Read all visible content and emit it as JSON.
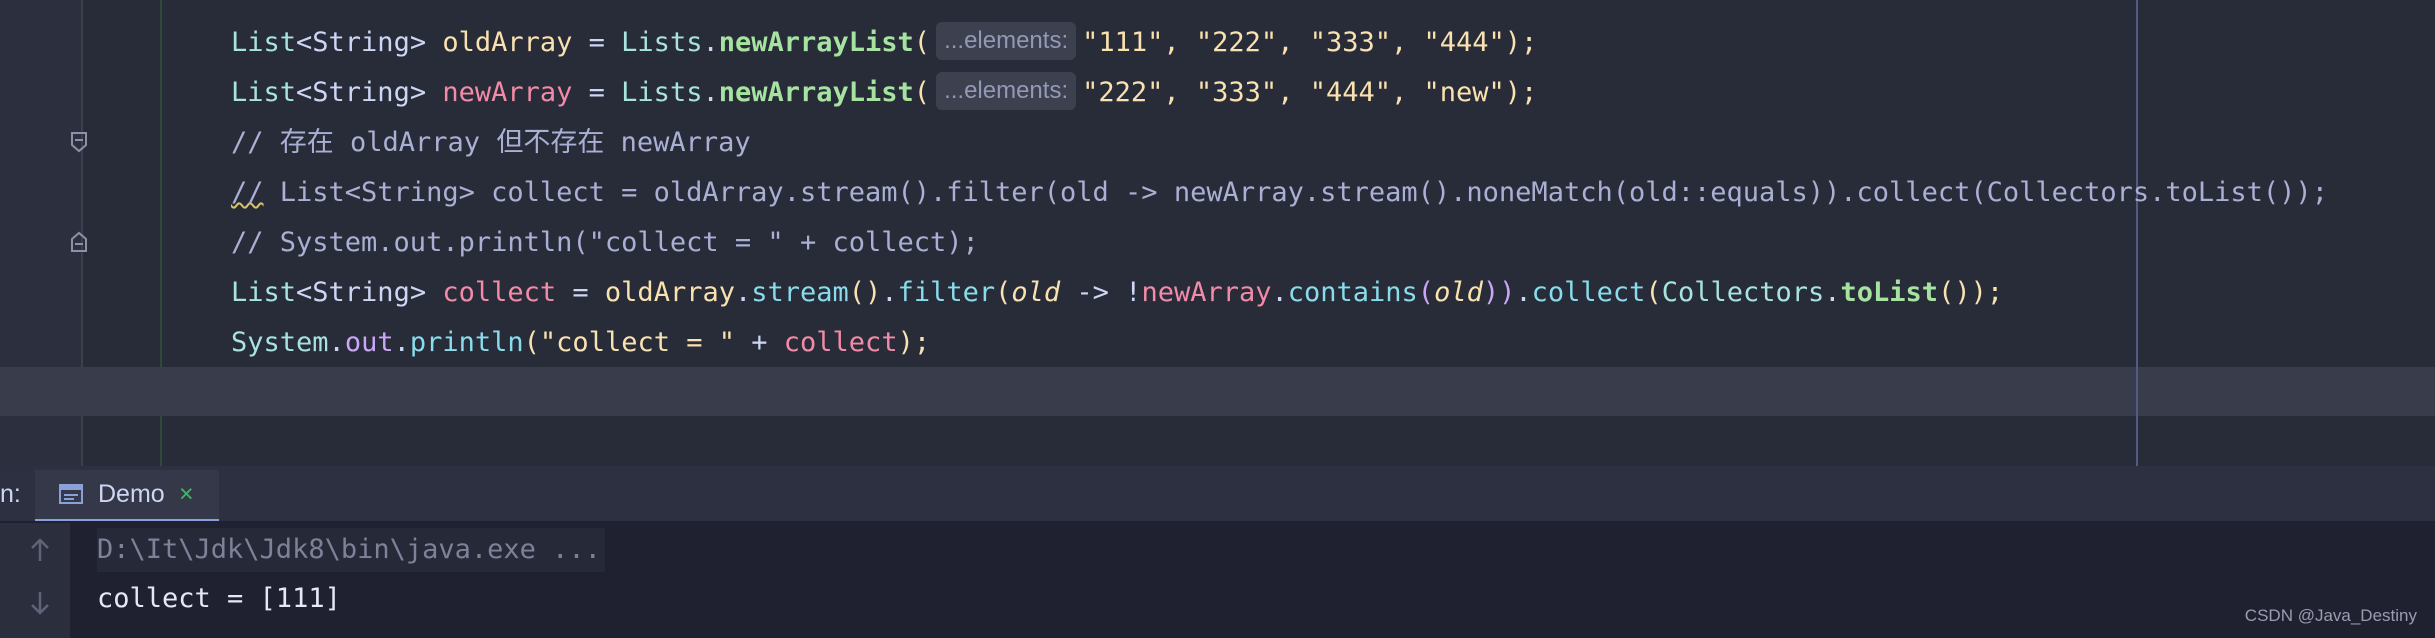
{
  "editor": {
    "line1": {
      "type_name": "List",
      "generic": "<String>",
      "var_name": "oldArray",
      "assign": " = ",
      "class_name": "Lists",
      "dot": ".",
      "method": "newArrayList",
      "open_paren": "(",
      "hint": "...elements:",
      "args": "\"111\", \"222\", \"333\", \"444\"",
      "close": ");"
    },
    "line2": {
      "type_name": "List",
      "generic": "<String>",
      "var_name": "newArray",
      "assign": " = ",
      "class_name": "Lists",
      "dot": ".",
      "method": "newArrayList",
      "open_paren": "(",
      "hint": "...elements:",
      "args": "\"222\", \"333\", \"444\", \"new\"",
      "close": ");"
    },
    "comment1": "// 存在 oldArray 但不存在 newArray",
    "comment2_prefix": "//",
    "comment2_rest": " List<String> collect = oldArray.stream().filter(old -> newArray.stream().noneMatch(old::equals)).collect(Collectors.toList());",
    "comment3": "// System.out.println(\"collect = \" + collect);",
    "line6": {
      "type_name": "List",
      "generic": "<String>",
      "var_name": "collect",
      "assign": " = ",
      "receiver": "oldArray",
      "dot1": ".",
      "call1": "stream",
      "parens1": "()",
      "dot2": ".",
      "call2": "filter",
      "open": "(",
      "param": "old",
      "arrow": " -> !",
      "ref": "newArray",
      "dot3": ".",
      "call3": "contains",
      "open2": "(",
      "param2": "old",
      "close2": "))",
      "dot4": ".",
      "call4": "collect",
      "open3": "(",
      "collectors": "Collectors",
      "dot5": ".",
      "tolist": "toList",
      "close3": "());"
    },
    "line7": {
      "system": "System",
      "dot1": ".",
      "out": "out",
      "dot2": ".",
      "println": "println",
      "open": "(",
      "str": "\"collect = \"",
      "plus": " + ",
      "var": "collect",
      "close": ");"
    }
  },
  "run_panel": {
    "label": "n:",
    "tab_label": "Demo",
    "tab_close": "×",
    "command": "D:\\It\\Jdk\\Jdk8\\bin\\java.exe ...",
    "output": "collect = [111]"
  },
  "watermark": "CSDN @Java_Destiny",
  "colors": {
    "editor_bg": "#282b38",
    "current_line": "#393c4b",
    "console_bg": "#1f2130"
  },
  "icons": [
    "fold-icon",
    "console-tab-icon",
    "scroll-up-icon",
    "scroll-down-icon",
    "close-icon"
  ]
}
